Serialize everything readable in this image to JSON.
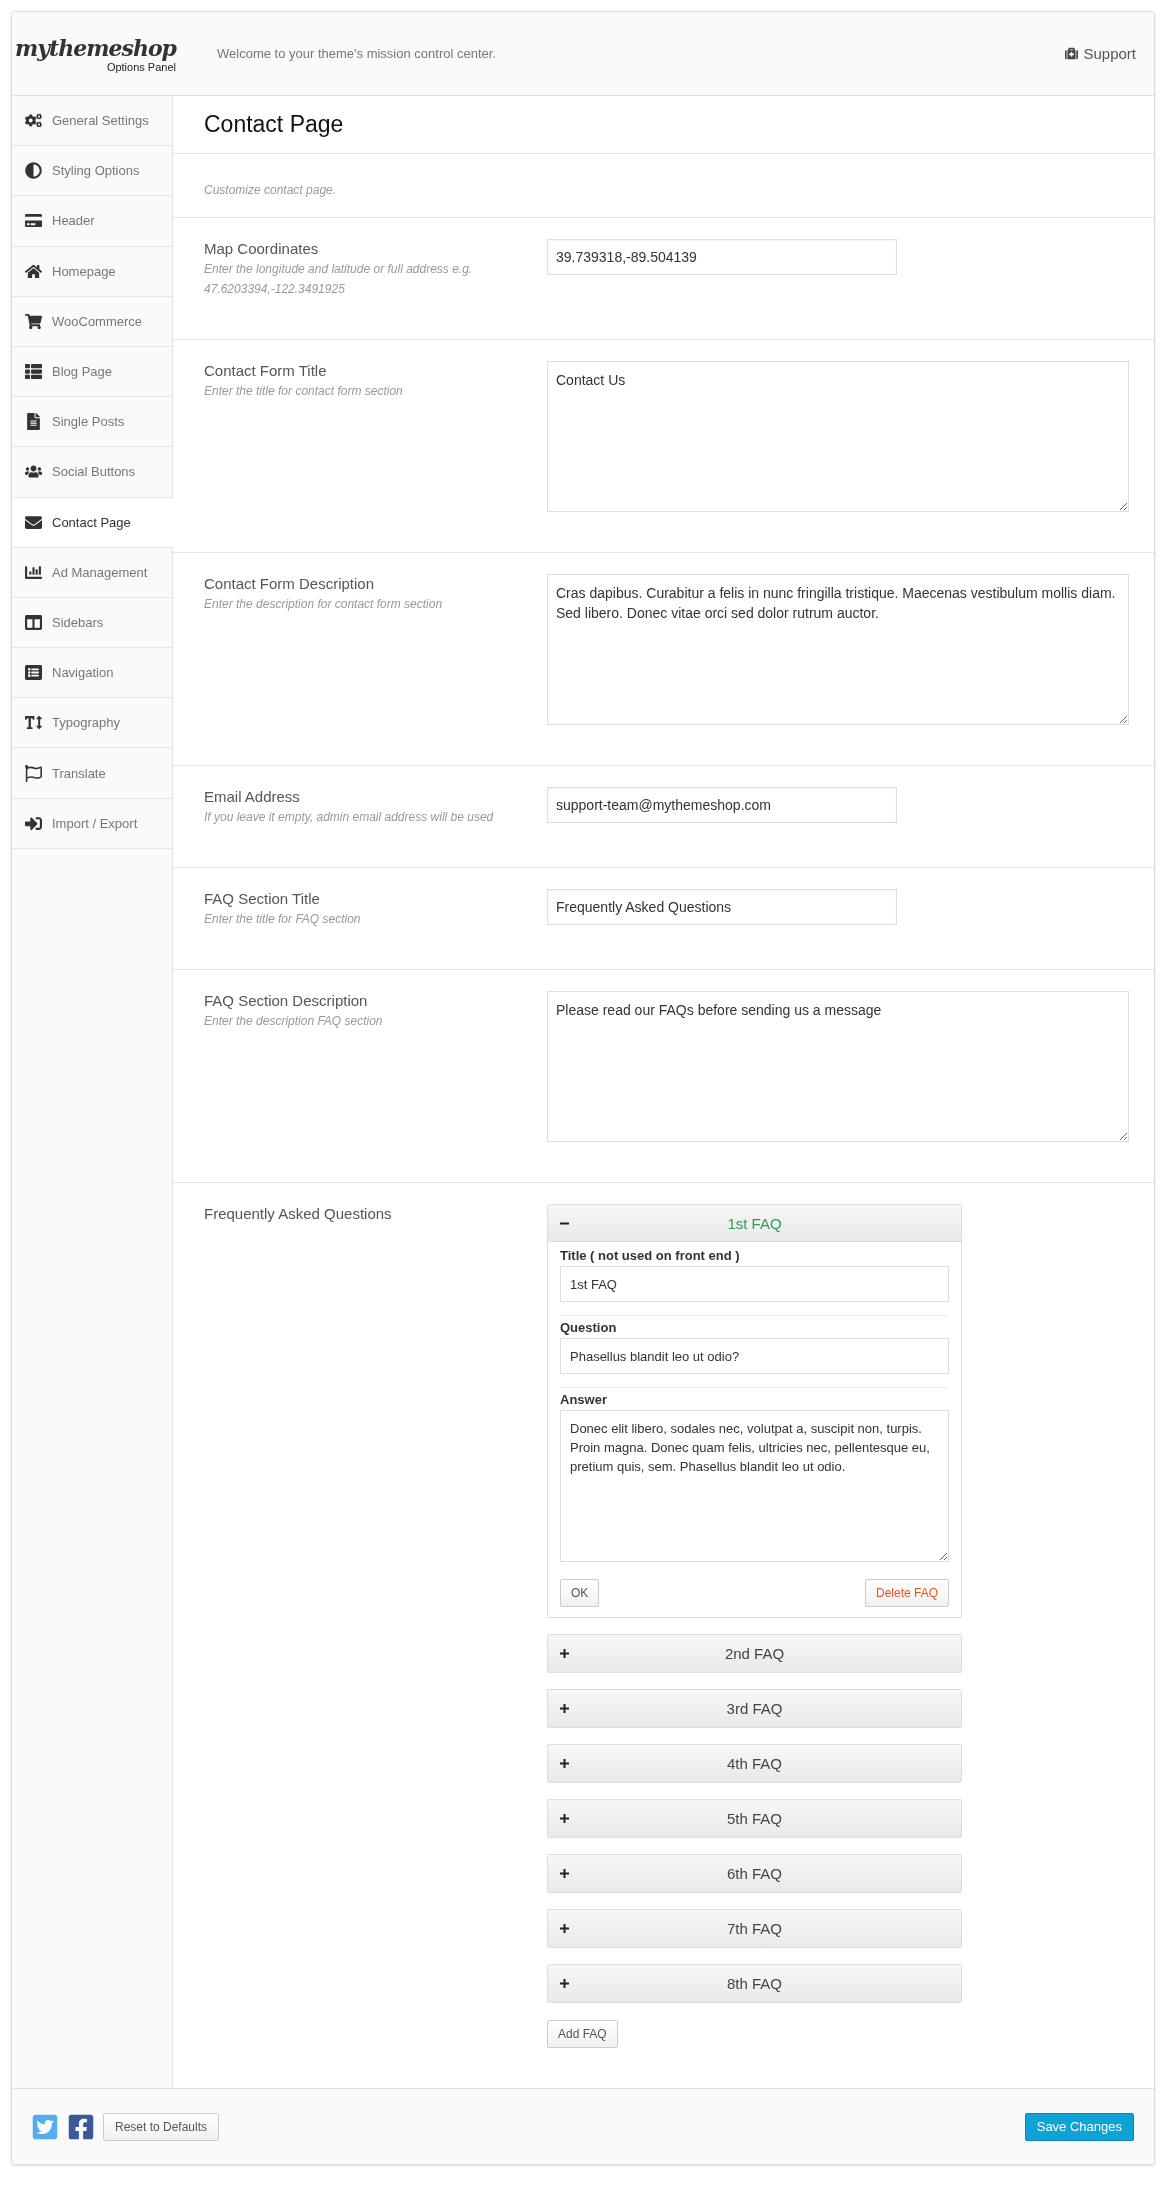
{
  "header": {
    "logo": "mythemeshop",
    "logo_subtitle": "Options Panel",
    "welcome": "Welcome to your theme's mission control center.",
    "support": "Support"
  },
  "sidebar": {
    "items": [
      {
        "label": "General Settings",
        "selected": false
      },
      {
        "label": "Styling Options",
        "selected": false
      },
      {
        "label": "Header",
        "selected": false
      },
      {
        "label": "Homepage",
        "selected": false
      },
      {
        "label": "WooCommerce",
        "selected": false
      },
      {
        "label": "Blog Page",
        "selected": false
      },
      {
        "label": "Single Posts",
        "selected": false
      },
      {
        "label": "Social Buttons",
        "selected": false
      },
      {
        "label": "Contact Page",
        "selected": true
      },
      {
        "label": "Ad Management",
        "selected": false
      },
      {
        "label": "Sidebars",
        "selected": false
      },
      {
        "label": "Navigation",
        "selected": false
      },
      {
        "label": "Typography",
        "selected": false
      },
      {
        "label": "Translate",
        "selected": false
      },
      {
        "label": "Import / Export",
        "selected": false
      }
    ]
  },
  "page": {
    "title": "Contact Page",
    "description": "Customize contact page."
  },
  "fields": [
    {
      "kind": "input",
      "label": "Map Coordinates",
      "hint": "Enter the longitude and latitude or full address e.g. 47.6203394,-122.3491925",
      "value": "39.739318,-89.504139"
    },
    {
      "kind": "textarea",
      "label": "Contact Form Title",
      "hint": "Enter the title for contact form section",
      "value": "Contact Us"
    },
    {
      "kind": "textarea",
      "label": "Contact Form Description",
      "hint": "Enter the description for contact form section",
      "value": "Cras dapibus. Curabitur a felis in nunc fringilla tristique. Maecenas vestibulum mollis diam. Sed libero. Donec vitae orci sed dolor rutrum auctor."
    },
    {
      "kind": "input",
      "label": "Email Address",
      "hint": "If you leave it empty, admin email address will be used",
      "value": "support-team@mythemeshop.com"
    },
    {
      "kind": "input",
      "label": "FAQ Section Title",
      "hint": "Enter the title for FAQ section",
      "value": "Frequently Asked Questions"
    },
    {
      "kind": "textarea",
      "label": "FAQ Section Description",
      "hint": "Enter the description FAQ section",
      "value": "Please read our FAQs before sending us a message"
    }
  ],
  "faq": {
    "label": "Frequently Asked Questions",
    "items": [
      {
        "title": "1st FAQ",
        "expanded": true,
        "title_label": "Title ( not used on front end )",
        "title_value": "1st FAQ",
        "question_label": "Question",
        "question_value": "Phasellus blandit leo ut odio?",
        "answer_label": "Answer",
        "answer_value": "Donec elit libero, sodales nec, volutpat a, suscipit non, turpis. Proin magna. Donec quam felis, ultricies nec, pellentesque eu, pretium quis, sem. Phasellus blandit leo ut odio.",
        "ok": "OK",
        "delete": "Delete FAQ"
      },
      {
        "title": "2nd FAQ",
        "expanded": false
      },
      {
        "title": "3rd FAQ",
        "expanded": false
      },
      {
        "title": "4th FAQ",
        "expanded": false
      },
      {
        "title": "5th FAQ",
        "expanded": false
      },
      {
        "title": "6th FAQ",
        "expanded": false
      },
      {
        "title": "7th FAQ",
        "expanded": false
      },
      {
        "title": "8th FAQ",
        "expanded": false
      }
    ],
    "add_button": "Add FAQ"
  },
  "footer": {
    "reset": "Reset to Defaults",
    "save": "Save Changes"
  }
}
